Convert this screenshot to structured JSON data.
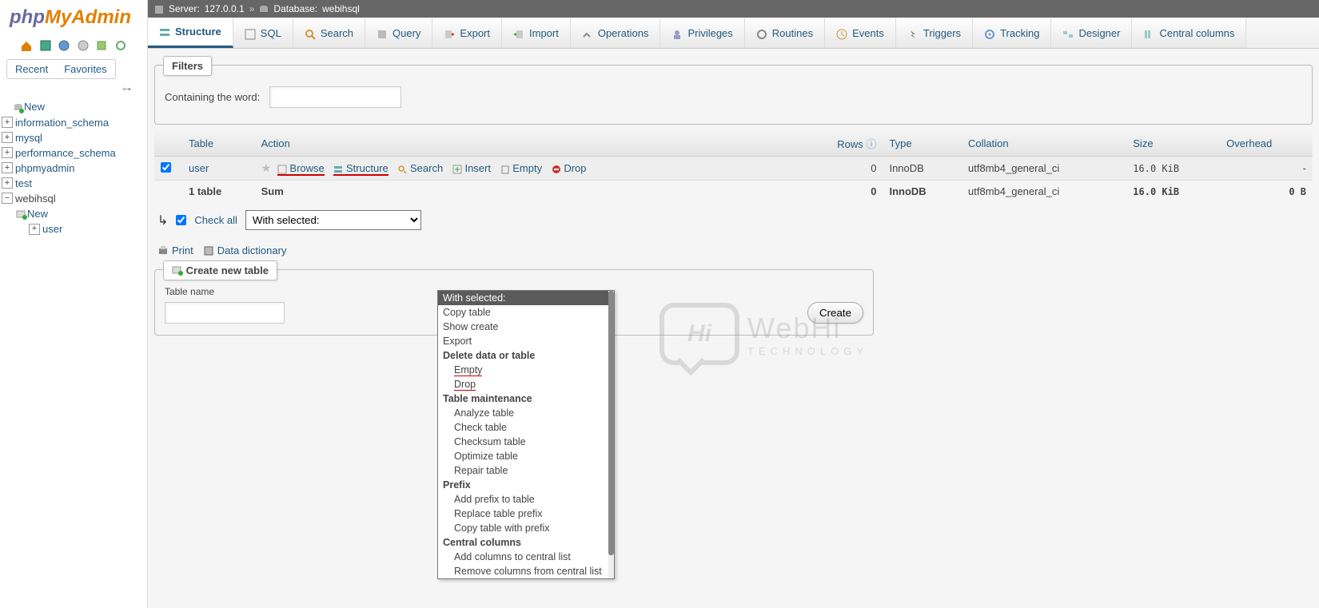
{
  "logo": {
    "part1": "php",
    "part2": "MyAdmin"
  },
  "sidebar_tabs": {
    "recent": "Recent",
    "favorites": "Favorites"
  },
  "tree": {
    "new": "New",
    "dbs": [
      "information_schema",
      "mysql",
      "performance_schema",
      "phpmyadmin",
      "test",
      "webihsql"
    ],
    "db_child_new": "New",
    "db_child_table": "user"
  },
  "breadcrumb": {
    "server_label": "Server:",
    "server": "127.0.0.1",
    "db_label": "Database:",
    "db": "webihsql"
  },
  "tabs": [
    "Structure",
    "SQL",
    "Search",
    "Query",
    "Export",
    "Import",
    "Operations",
    "Privileges",
    "Routines",
    "Events",
    "Triggers",
    "Tracking",
    "Designer",
    "Central columns"
  ],
  "filters": {
    "legend": "Filters",
    "label": "Containing the word:"
  },
  "table_headers": {
    "table": "Table",
    "action": "Action",
    "rows": "Rows",
    "type": "Type",
    "collation": "Collation",
    "size": "Size",
    "overhead": "Overhead"
  },
  "table_rows": [
    {
      "name": "user",
      "rows": "0",
      "type": "InnoDB",
      "collation": "utf8mb4_general_ci",
      "size": "16.0 KiB",
      "overhead": "-"
    }
  ],
  "actions": {
    "browse": "Browse",
    "structure": "Structure",
    "search": "Search",
    "insert": "Insert",
    "empty": "Empty",
    "drop": "Drop"
  },
  "summary": {
    "count": "1 table",
    "sum": "Sum",
    "rows": "0",
    "type": "InnoDB",
    "collation": "utf8mb4_general_ci",
    "size": "16.0 KiB",
    "overhead": "0 B"
  },
  "checkall": {
    "label": "Check all",
    "select_label": "With selected:"
  },
  "dropdown": {
    "sel": "With selected:",
    "copy": "Copy table",
    "show_create": "Show create",
    "export": "Export",
    "g_delete": "Delete data or table",
    "empty": "Empty",
    "drop": "Drop",
    "g_maint": "Table maintenance",
    "analyze": "Analyze table",
    "check": "Check table",
    "checksum": "Checksum table",
    "optimize": "Optimize table",
    "repair": "Repair table",
    "g_prefix": "Prefix",
    "add_prefix": "Add prefix to table",
    "replace_prefix": "Replace table prefix",
    "copy_prefix": "Copy table with prefix",
    "g_central": "Central columns",
    "add_central": "Add columns to central list",
    "remove_central": "Remove columns from central list"
  },
  "links": {
    "print": "Print",
    "dd": "Data dictionary"
  },
  "create": {
    "legend": "Create new table",
    "name_label": "Table name",
    "btn": "Create"
  },
  "watermark": {
    "box": "Hi",
    "t1": "WebHi",
    "t2": "TECHNOLOGY"
  }
}
